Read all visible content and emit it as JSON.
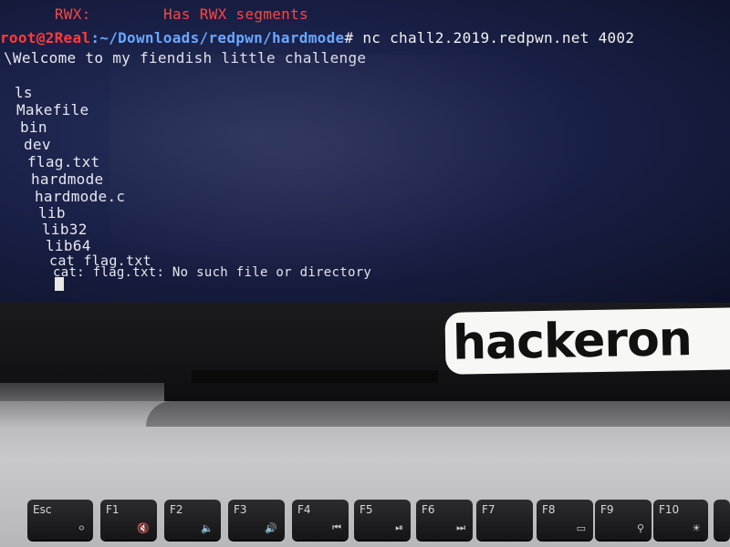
{
  "terminal": {
    "lines": [
      {
        "text": "  RWX:        Has RWX segments",
        "color": "#ff4444"
      },
      {
        "user": "root@2Real",
        "path": ":~/Downloads/redpwn/hardmode",
        "cmd": "# nc chall2.2019.redpwn.net 4002"
      },
      {
        "text": "\\Welcome to my fiendish little challenge"
      },
      {
        "text": "ls"
      },
      {
        "text": "Makefile"
      },
      {
        "text": "bin"
      },
      {
        "text": "dev"
      },
      {
        "text": "flag.txt"
      },
      {
        "text": "hardmode"
      },
      {
        "text": "hardmode.c"
      },
      {
        "text": "lib"
      },
      {
        "text": "lib32"
      },
      {
        "text": "lib64"
      },
      {
        "text": "cat flag.txt"
      },
      {
        "text": "cat: flag.txt: No such file or directory"
      }
    ]
  },
  "sticker": {
    "text": "hackeron"
  },
  "keyboard": {
    "keys": [
      {
        "label": "Esc",
        "icon": "lock-icon"
      },
      {
        "label": "F1",
        "icon": "mute-icon"
      },
      {
        "label": "F2",
        "icon": "volume-down-icon"
      },
      {
        "label": "F3",
        "icon": "volume-up-icon"
      },
      {
        "label": "F4",
        "icon": "prev-track-icon"
      },
      {
        "label": "F5",
        "icon": "play-pause-icon"
      },
      {
        "label": "F6",
        "icon": "next-track-icon"
      },
      {
        "label": "F7",
        "icon": ""
      },
      {
        "label": "F8",
        "icon": "display-icon"
      },
      {
        "label": "F9",
        "icon": "search-icon"
      },
      {
        "label": "F10",
        "icon": "brightness-icon"
      }
    ]
  }
}
